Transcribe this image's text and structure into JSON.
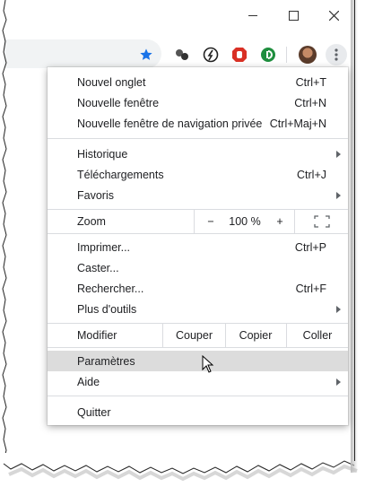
{
  "window": {
    "minimize_label": "—",
    "maximize_label": "☐",
    "close_label": "✕"
  },
  "toolbar": {
    "icons": [
      "star-icon",
      "extension-dots-icon",
      "extension-speed-icon",
      "extension-stop-icon",
      "extension-green-d-icon",
      "profile-avatar",
      "menu-kebab-icon"
    ],
    "colors": {
      "star": "#1a73e8",
      "stop": "#d93025",
      "green": "#1e8e3e"
    }
  },
  "menu": {
    "group1": [
      {
        "label": "Nouvel onglet",
        "shortcut": "Ctrl+T"
      },
      {
        "label": "Nouvelle fenêtre",
        "shortcut": "Ctrl+N"
      },
      {
        "label": "Nouvelle fenêtre de navigation privée",
        "shortcut": "Ctrl+Maj+N"
      }
    ],
    "group2": [
      {
        "label": "Historique",
        "submenu": true
      },
      {
        "label": "Téléchargements",
        "shortcut": "Ctrl+J"
      },
      {
        "label": "Favoris",
        "submenu": true
      }
    ],
    "zoom": {
      "label": "Zoom",
      "minus": "−",
      "value": "100 %",
      "plus": "+"
    },
    "group3": [
      {
        "label": "Imprimer...",
        "shortcut": "Ctrl+P"
      },
      {
        "label": "Caster..."
      },
      {
        "label": "Rechercher...",
        "shortcut": "Ctrl+F"
      },
      {
        "label": "Plus d'outils",
        "submenu": true
      }
    ],
    "edit": {
      "label": "Modifier",
      "cut": "Couper",
      "copy": "Copier",
      "paste": "Coller"
    },
    "group4": [
      {
        "label": "Paramètres",
        "highlighted": true
      },
      {
        "label": "Aide",
        "submenu": true
      }
    ],
    "group5": [
      {
        "label": "Quitter"
      }
    ]
  }
}
